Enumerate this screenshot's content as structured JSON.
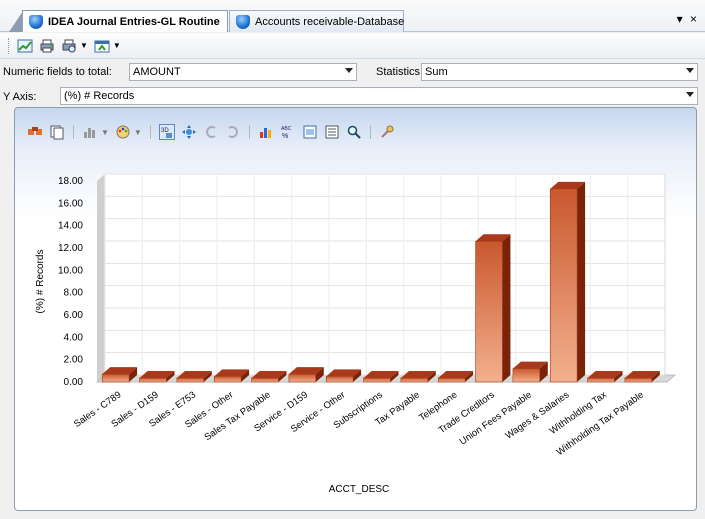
{
  "tabs": [
    {
      "label": "IDEA Journal Entries-GL Routine",
      "active": true
    },
    {
      "label": "Accounts receivable-Database",
      "active": false
    }
  ],
  "tab_controls": {
    "menu": "▾",
    "close": "×"
  },
  "toolbar": {
    "icons": [
      "chart-icon",
      "print-icon",
      "print-preview-icon",
      "export-icon"
    ]
  },
  "fields": {
    "numeric_label": "Numeric fields to total:",
    "numeric_value": "AMOUNT",
    "statistics_label": "Statistics:",
    "statistics_value": "Sum",
    "yaxis_label": "Y Axis:",
    "yaxis_value": "(%) # Records"
  },
  "chart_toolbar": {
    "icons": [
      "data-editor-icon",
      "copy-icon",
      "chart-type-icon",
      "palette-icon",
      "3d-icon",
      "rotate-icon",
      "back-icon",
      "forward-icon",
      "chart-wizard-icon",
      "abc-labels-icon",
      "legend-icon",
      "properties-icon",
      "zoom-icon",
      "tools-icon"
    ]
  },
  "colors": {
    "bar_front_top": "#f3b08e",
    "bar_front_bottom": "#c4552b",
    "bar_side": "#7a2308",
    "bar_top": "#a9391a",
    "axis_wall": "#cfcfcf"
  },
  "chart_data": {
    "type": "bar",
    "title": "",
    "xlabel": "ACCT_DESC",
    "ylabel": "(%) # Records",
    "ylim": [
      0,
      18
    ],
    "yticks": [
      "0.00",
      "2.00",
      "4.00",
      "6.00",
      "8.00",
      "10.00",
      "12.00",
      "14.00",
      "16.00",
      "18.00"
    ],
    "grid": true,
    "three_d": true,
    "categories": [
      "Sales - C789",
      "Sales - D159",
      "Sales - E753",
      "Sales - Other",
      "Sales Tax Payable",
      "Service - D159",
      "Service - Other",
      "Subscriptions",
      "Tax Payable",
      "Telephone",
      "Trade Creditors",
      "Union Fees Payable",
      "Wages & Salaries",
      "Withholding Tax",
      "Withholding Tax Payable"
    ],
    "values": [
      0.7,
      0.2,
      0.2,
      0.5,
      0.05,
      0.7,
      0.5,
      0.3,
      0.05,
      0.3,
      12.6,
      1.2,
      17.3,
      0.05,
      0.05
    ]
  }
}
